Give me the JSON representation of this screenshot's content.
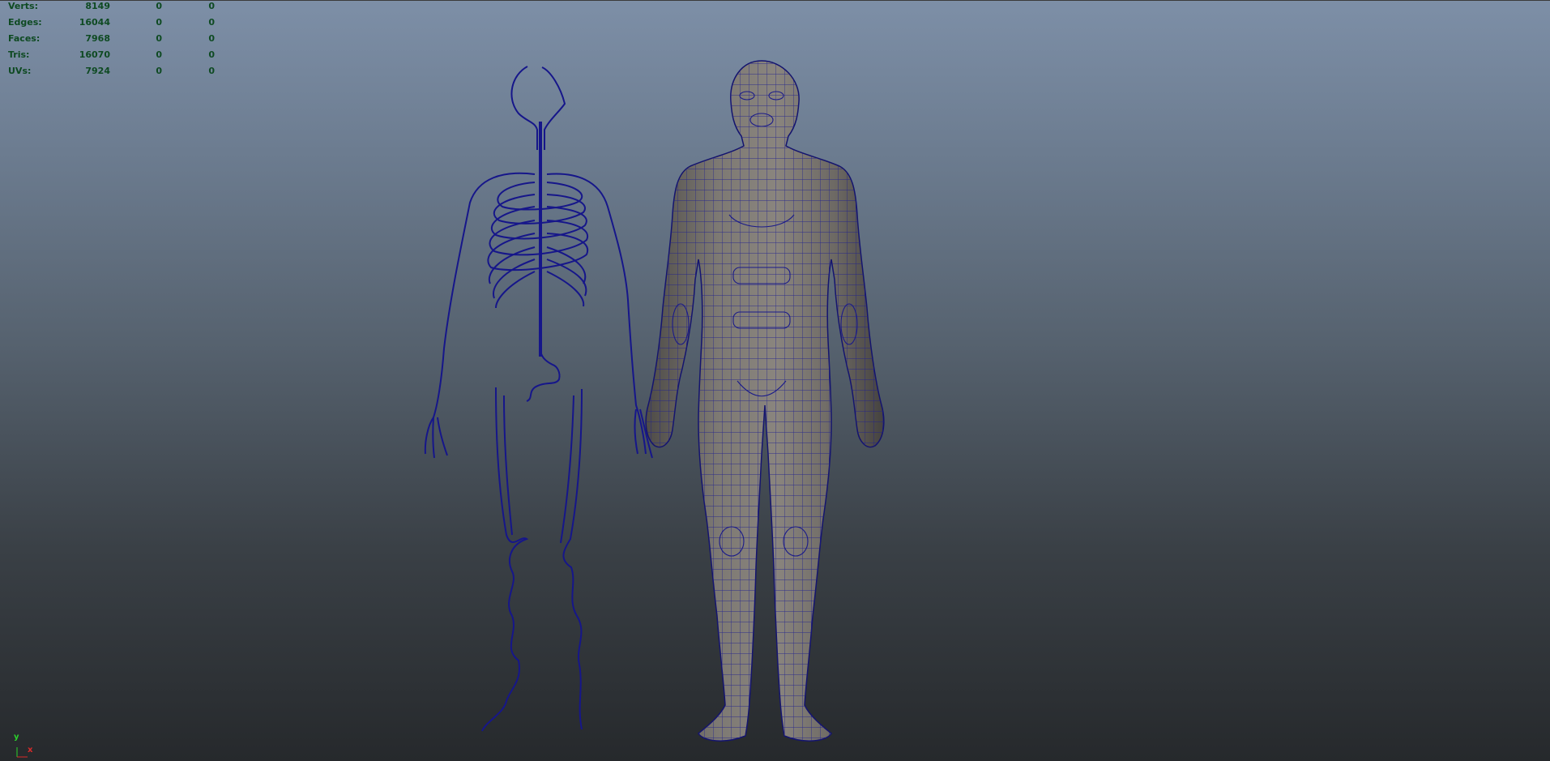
{
  "hud": {
    "rows": [
      {
        "label": "Verts:",
        "v1": "8149",
        "v2": "0",
        "v3": "0"
      },
      {
        "label": "Edges:",
        "v1": "16044",
        "v2": "0",
        "v3": "0"
      },
      {
        "label": "Faces:",
        "v1": "7968",
        "v2": "0",
        "v3": "0"
      },
      {
        "label": "Tris:",
        "v1": "16070",
        "v2": "0",
        "v3": "0"
      },
      {
        "label": "UVs:",
        "v1": "7924",
        "v2": "0",
        "v3": "0"
      }
    ]
  },
  "axis": {
    "y_label": "y",
    "x_label": "x"
  },
  "colors": {
    "wireframe": "#1a1a8c",
    "mesh_fill": "#7a7670",
    "hud_text": "#0e4a22",
    "axis_y": "#2bd12b",
    "axis_x": "#d92a2a"
  }
}
